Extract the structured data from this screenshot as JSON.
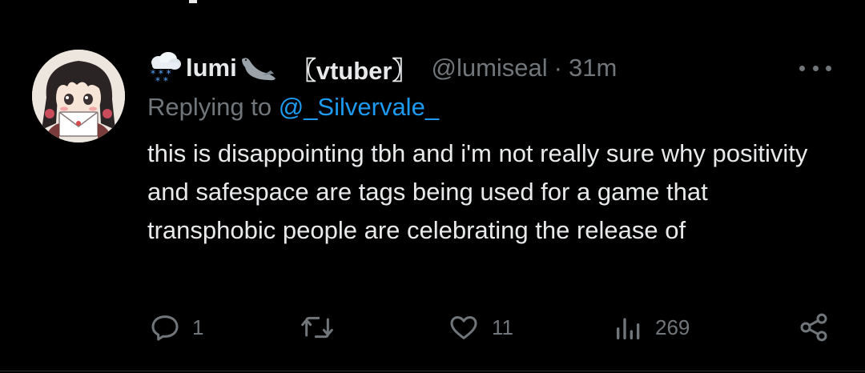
{
  "author": {
    "display_name": "lumi",
    "tag": "〖vtuber〗",
    "handle": "@lumiseal",
    "separator": "·",
    "timestamp": "31m",
    "name_emoji_left": "snow-cloud-icon",
    "name_emoji_right": "seal-icon"
  },
  "reply": {
    "prefix": "Replying to",
    "mention": "@_Silvervale_"
  },
  "tweet": {
    "text": "this is disappointing tbh and i'm not really sure why positivity and safespace are tags being used for a game that transphobic people are celebrating the release of"
  },
  "actions": {
    "replies": "1",
    "retweets": "",
    "likes": "11",
    "views": "269"
  },
  "colors": {
    "background": "#000000",
    "text": "#e7e9ea",
    "secondary": "#71767b",
    "link": "#1d9bf0"
  }
}
